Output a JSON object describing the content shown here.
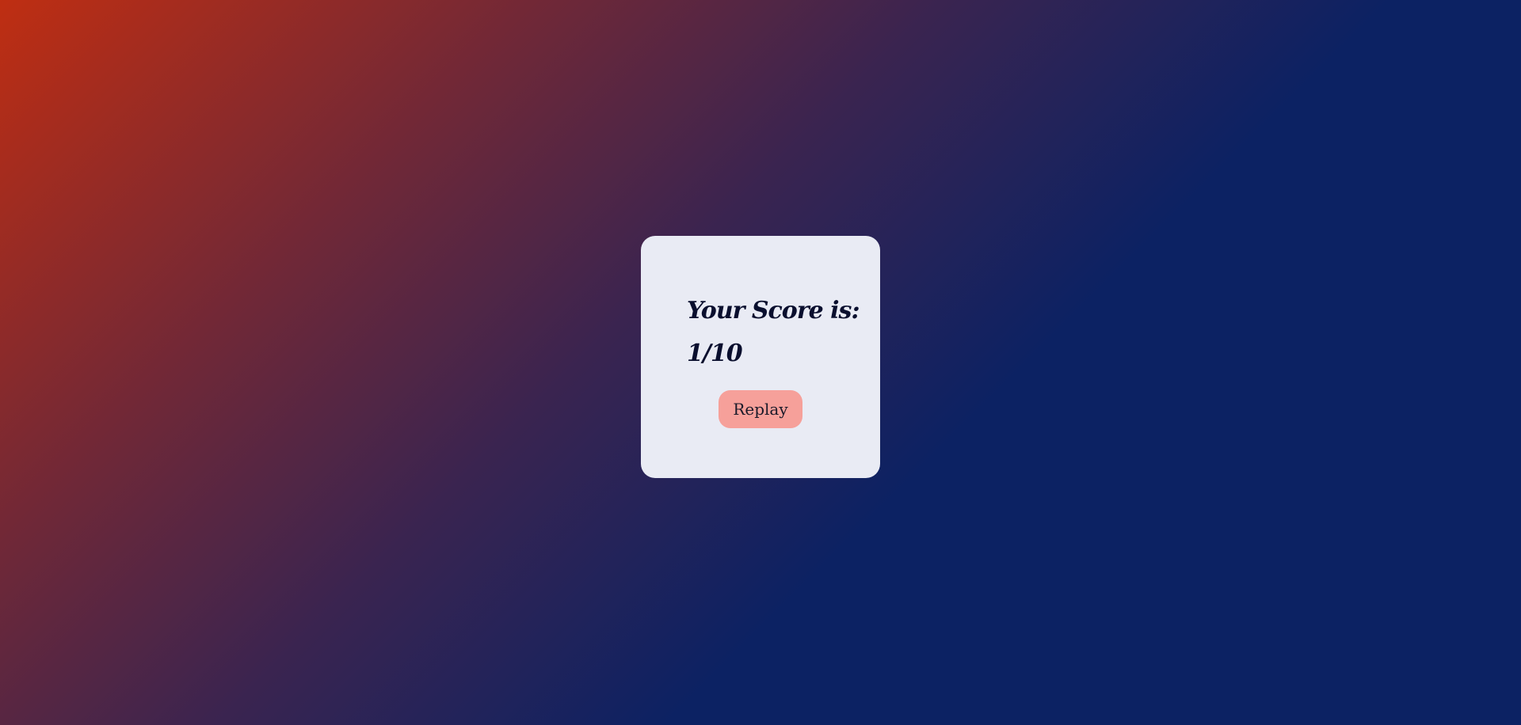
{
  "result": {
    "heading": "Your Score is:",
    "score": "1/10",
    "replay_label": "Replay"
  },
  "colors": {
    "gradient_start": "#bf2e12",
    "gradient_end": "#0c2263",
    "card_background": "#e9ebf4",
    "button_background": "#f6a09a",
    "text": "#0a0f2e"
  }
}
